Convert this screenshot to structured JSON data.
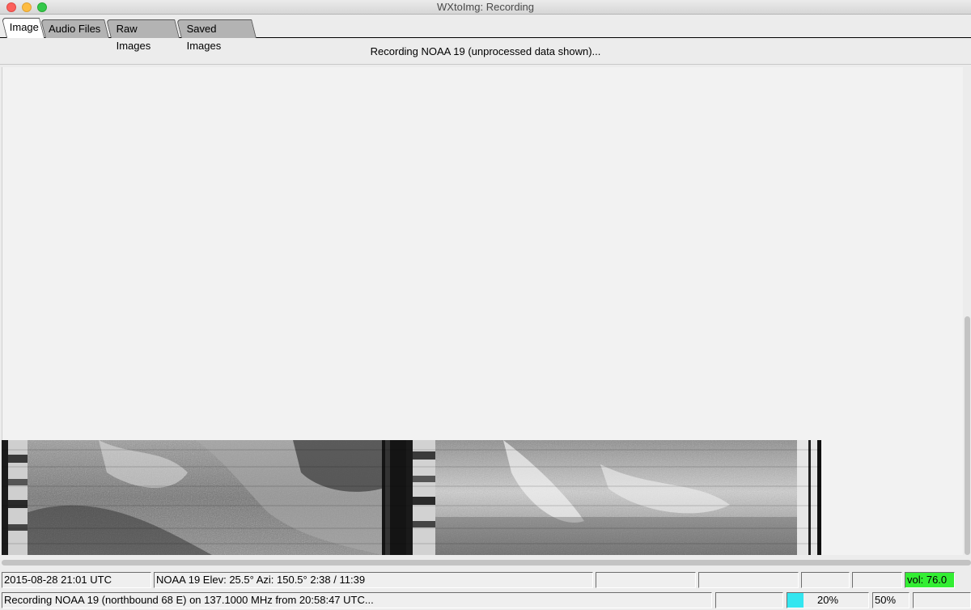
{
  "window": {
    "title": "WXtoImg: Recording"
  },
  "tabs": [
    {
      "label": "Image",
      "active": true
    },
    {
      "label": "Audio Files",
      "active": false
    },
    {
      "label": "Raw Images",
      "active": false
    },
    {
      "label": "Saved Images",
      "active": false
    }
  ],
  "heading": "Recording NOAA 19 (unprocessed data shown)...",
  "status_row1": {
    "datetime": "2015-08-28  21:01 UTC",
    "pass_info": "NOAA 19   Elev: 25.5°   Azi: 150.5°   2:38 / 11:39",
    "empty1": "",
    "empty2": "",
    "empty3": "",
    "empty4": "",
    "volume": "vol: 76.0"
  },
  "status_row2": {
    "message": "Recording NOAA 19 (northbound 68 E) on 137.1000 MHz from 20:58:47 UTC...",
    "empty1": "",
    "signal_meter": {
      "label": "20%",
      "value": 0.2
    },
    "zoom": "50%",
    "empty2": ""
  },
  "colors": {
    "volume_bg": "#33ee33",
    "meter_fill": "#33e6f0",
    "active_tab": "#ffffff",
    "inactive_tab": "#b3b3b3"
  }
}
